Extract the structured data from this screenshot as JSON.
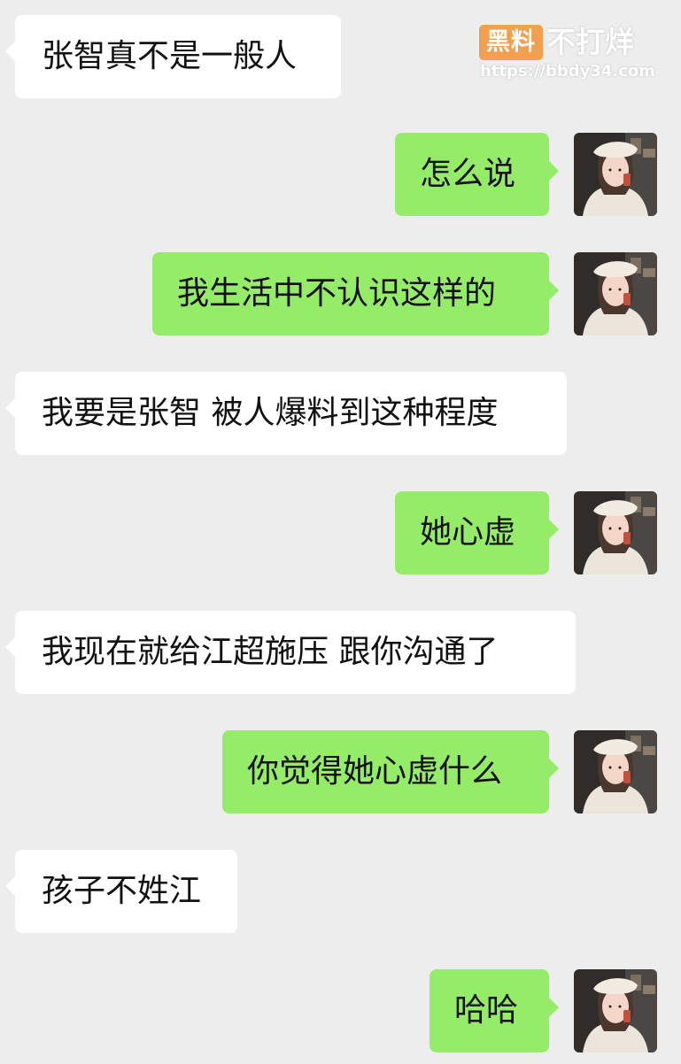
{
  "watermark": {
    "badge": "黑料",
    "name": "不打烊",
    "url": "https://bbdy34.com"
  },
  "colors": {
    "background": "#ededed",
    "incoming_bubble": "#ffffff",
    "outgoing_bubble": "#95ec69",
    "watermark_badge": "#f2a04f"
  },
  "messages": [
    {
      "side": "left",
      "text": "张智真不是一般人"
    },
    {
      "side": "right",
      "text": "怎么说",
      "avatar": "user-avatar"
    },
    {
      "side": "right",
      "text": "我生活中不认识这样的",
      "avatar": "user-avatar"
    },
    {
      "side": "left",
      "text": "我要是张智  被人爆料到这种程度"
    },
    {
      "side": "right",
      "text": "她心虚",
      "avatar": "user-avatar"
    },
    {
      "side": "left",
      "text": "我现在就给江超施压   跟你沟通了"
    },
    {
      "side": "right",
      "text": "你觉得她心虚什么",
      "avatar": "user-avatar"
    },
    {
      "side": "left",
      "text": "孩子不姓江"
    },
    {
      "side": "right",
      "text": "哈哈",
      "avatar": "user-avatar"
    }
  ]
}
